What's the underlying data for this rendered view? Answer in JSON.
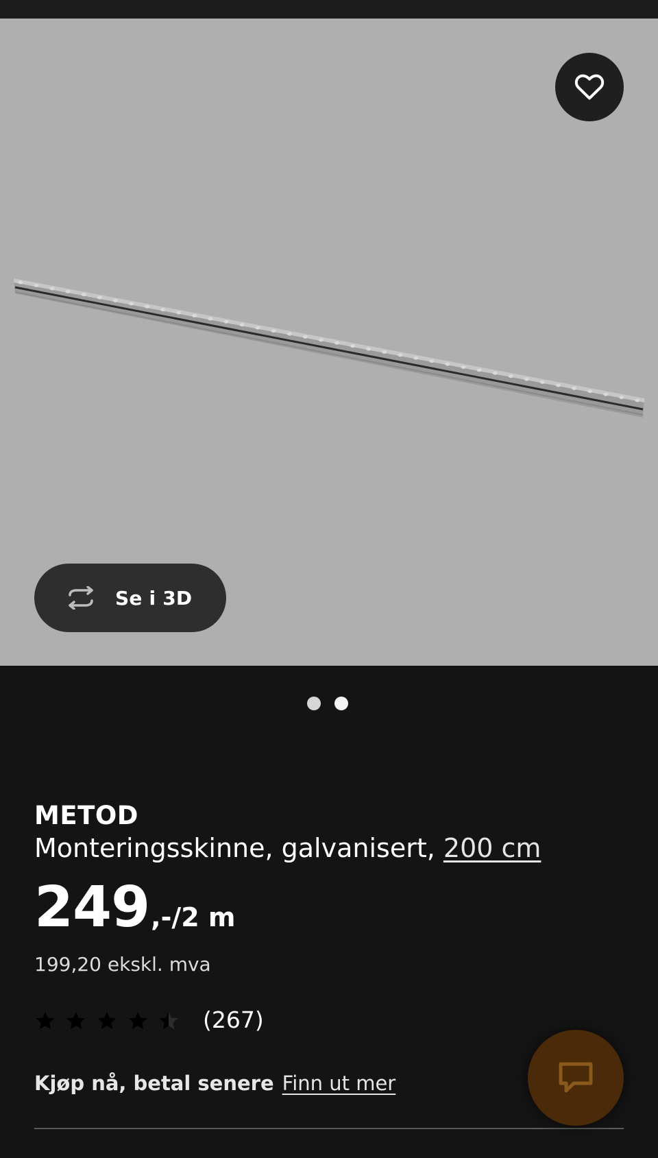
{
  "product": {
    "brand": "METOD",
    "description": "Monteringsskinne, galvanisert,",
    "size_link": "200 cm",
    "price_integer": "249",
    "price_suffix": ",-/2 m",
    "price_ex_vat": "199,20 ekskl. mva",
    "rating": {
      "stars": 4.5,
      "max_stars": 5,
      "review_count": "(267)"
    }
  },
  "image": {
    "view_3d_label": "Se i 3D",
    "carousel": {
      "total": 2,
      "active": 1
    }
  },
  "payment": {
    "bnpl_text": "Kjøp nå, betal senere",
    "bnpl_link": "Finn ut mer"
  },
  "icons": {
    "favorite": "heart-icon",
    "view_3d": "rotate-3d-icon",
    "chat": "chat-bubble-icon",
    "star": "star-icon"
  },
  "colors": {
    "background": "#141414",
    "image_background": "#afafaf",
    "chat_button": "#4a2a08"
  }
}
